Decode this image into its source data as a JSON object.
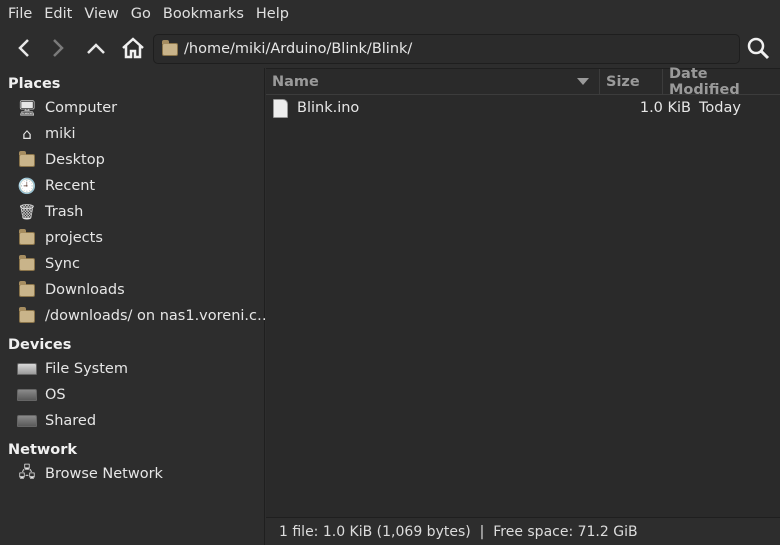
{
  "menu": [
    "File",
    "Edit",
    "View",
    "Go",
    "Bookmarks",
    "Help"
  ],
  "toolbar": {
    "path": "/home/miki/Arduino/Blink/Blink/"
  },
  "sidebar": {
    "places_label": "Places",
    "places": [
      "Computer",
      "miki",
      "Desktop",
      "Recent",
      "Trash",
      "projects",
      "Sync",
      "Downloads",
      "/downloads/ on nas1.voreni.c…"
    ],
    "devices_label": "Devices",
    "devices": [
      "File System",
      "OS",
      "Shared"
    ],
    "network_label": "Network",
    "network": [
      "Browse Network"
    ]
  },
  "columns": {
    "name": "Name",
    "size": "Size",
    "date": "Date Modified",
    "sort": "descending-on-name"
  },
  "files": [
    {
      "name": "Blink.ino",
      "size": "1.0 KiB",
      "date": "Today"
    }
  ],
  "status": "1 file: 1.0 KiB (1,069 bytes)  |  Free space: 71.2 GiB"
}
